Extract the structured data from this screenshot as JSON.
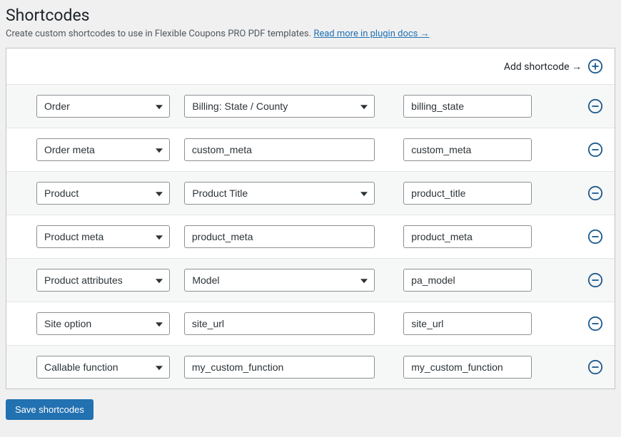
{
  "page": {
    "title": "Shortcodes",
    "subtitle_prefix": "Create custom shortcodes to use in Flexible Coupons PRO PDF templates. ",
    "subtitle_link": "Read more in plugin docs →"
  },
  "add": {
    "label": "Add shortcode →"
  },
  "colors": {
    "accent": "#2271b1",
    "icon_ring": "#1e5b8f"
  },
  "rows": [
    {
      "type": "Order",
      "second_kind": "select",
      "second": "Billing: State / County",
      "value": "billing_state"
    },
    {
      "type": "Order meta",
      "second_kind": "text",
      "second": "custom_meta",
      "value": "custom_meta"
    },
    {
      "type": "Product",
      "second_kind": "select",
      "second": "Product Title",
      "value": "product_title"
    },
    {
      "type": "Product meta",
      "second_kind": "text",
      "second": "product_meta",
      "value": "product_meta"
    },
    {
      "type": "Product attributes",
      "second_kind": "select",
      "second": "Model",
      "value": "pa_model"
    },
    {
      "type": "Site option",
      "second_kind": "text",
      "second": "site_url",
      "value": "site_url"
    },
    {
      "type": "Callable function",
      "second_kind": "text",
      "second": "my_custom_function",
      "value": "my_custom_function"
    }
  ],
  "save": {
    "label": "Save shortcodes"
  }
}
